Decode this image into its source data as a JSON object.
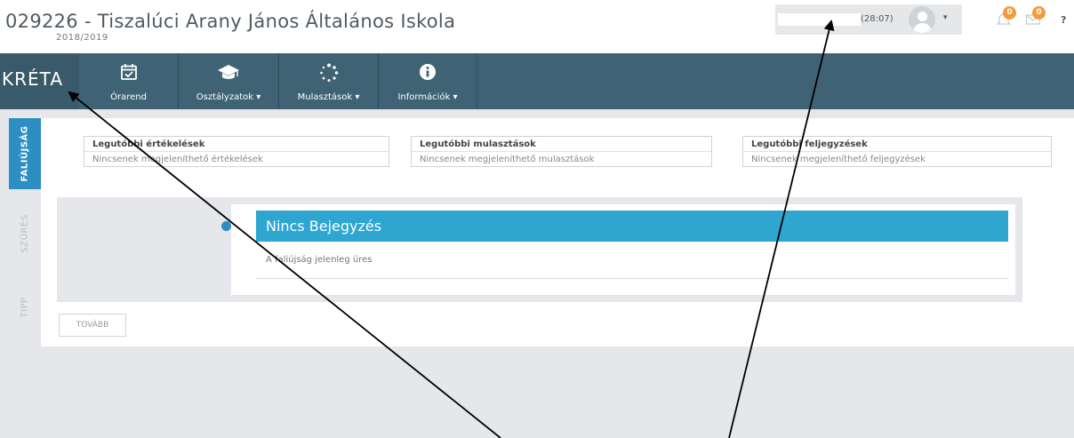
{
  "header": {
    "school_title": "029226 - Tiszalúci Arany János Általános Iskola",
    "school_year": "2018/2019",
    "session_timer": "(28:07)",
    "notifications_count": "0",
    "messages_count": "0",
    "help_label": "?"
  },
  "nav": {
    "brand": "KRÉTA",
    "items": [
      {
        "label": "Órarend",
        "icon": "calendar-check-icon"
      },
      {
        "label": "Osztályzatok ▾",
        "icon": "graduation-cap-icon"
      },
      {
        "label": "Mulasztások ▾",
        "icon": "spinner-icon"
      },
      {
        "label": "Információk ▾",
        "icon": "info-circle-icon"
      }
    ]
  },
  "side_tabs": {
    "faliujsag": "FALIÚJSÁG",
    "szures": "SZŰRÉS",
    "tipp": "TIPP"
  },
  "summary": [
    {
      "title": "Legutóbbi értékelések",
      "text": "Nincsenek megjeleníthető értékelések"
    },
    {
      "title": "Legutóbbi mulasztások",
      "text": "Nincsenek megjeleníthető mulasztások"
    },
    {
      "title": "Legutóbbi feljegyzések",
      "text": "Nincsenek megjeleníthető feljegyzések"
    }
  ],
  "entry": {
    "title": "Nincs Bejegyzés",
    "body": "A faliújság jelenleg üres"
  },
  "more_button": "TOVÁBB",
  "colors": {
    "navbar": "#3f6374",
    "accent_blue": "#2d8ec4",
    "entry_header": "#2ea6d0",
    "badge": "#f59a3c",
    "content_bg": "#e5e7ea"
  }
}
